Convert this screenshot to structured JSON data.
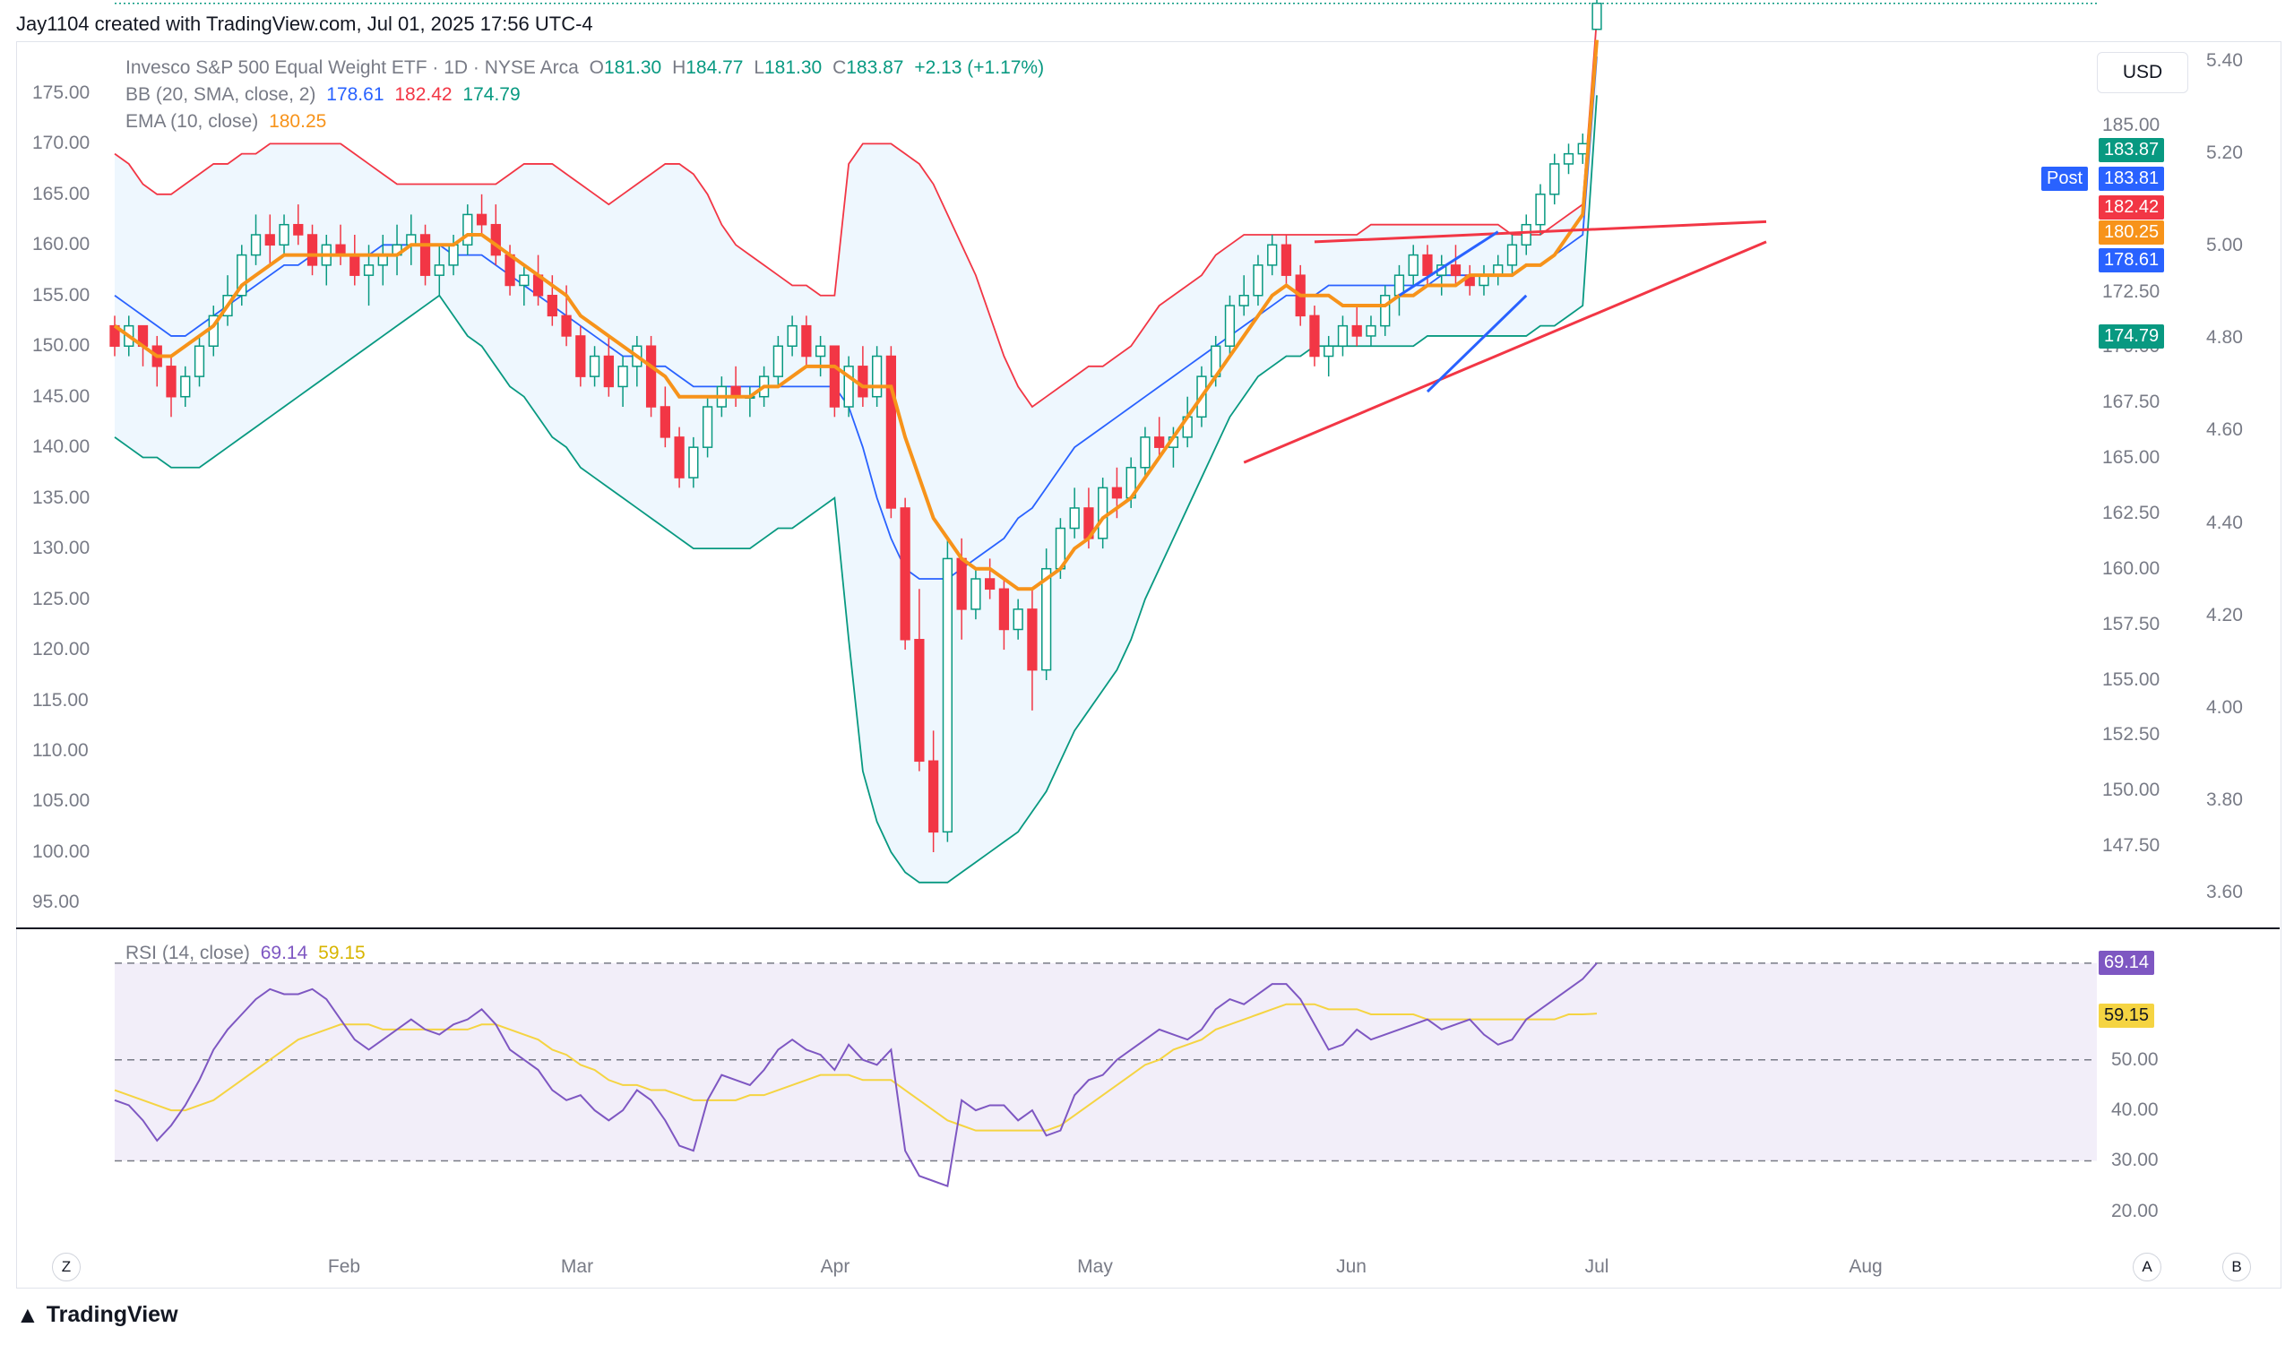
{
  "header": {
    "text": "Jay1104 created with TradingView.com, Jul 01, 2025 17:56 UTC-4"
  },
  "currency_button": "USD",
  "legend": {
    "symbol": "Invesco S&P 500 Equal Weight ETF · 1D · NYSE Arca",
    "o_label": "O",
    "o_value": "181.30",
    "h_label": "H",
    "h_value": "184.77",
    "l_label": "L",
    "l_value": "181.30",
    "c_label": "C",
    "c_value": "183.87",
    "change": "+2.13 (+1.17%)",
    "bb_label": "BB (20, SMA, close, 2)",
    "bb_basis": "178.61",
    "bb_upper": "182.42",
    "bb_lower": "174.79",
    "ema_label": "EMA (10, close)",
    "ema_value": "180.25",
    "rsi_label": "RSI (14, close)",
    "rsi_value": "69.14",
    "rsi_ma": "59.15"
  },
  "price_tags": {
    "last": "183.87",
    "post_label": "Post",
    "post": "183.81",
    "bb_upper": "182.42",
    "ema": "180.25",
    "bb_basis": "178.61",
    "bb_lower": "174.79",
    "rsi": "69.14",
    "rsi_ma": "59.15"
  },
  "colors": {
    "up": "#089981",
    "down": "#f23645",
    "bb_upper": "#f23645",
    "bb_basis": "#2962ff",
    "bb_lower": "#089981",
    "ema": "#f7931a",
    "rsi": "#7e57c2",
    "rsi_ma": "#f5d442",
    "post": "#2962ff"
  },
  "left_axis": [
    "175.00",
    "170.00",
    "165.00",
    "160.00",
    "155.00",
    "150.00",
    "145.00",
    "140.00",
    "135.00",
    "130.00",
    "125.00",
    "120.00",
    "115.00",
    "110.00",
    "105.00",
    "100.00",
    "95.00"
  ],
  "right_axis_mid": [
    "185.00",
    "177.50",
    "172.50",
    "170.00",
    "167.50",
    "165.00",
    "162.50",
    "160.00",
    "157.50",
    "155.00",
    "152.50",
    "150.00",
    "147.50"
  ],
  "right_axis_outer": [
    "5.40",
    "5.20",
    "5.00",
    "4.80",
    "4.60",
    "4.40",
    "4.20",
    "4.00",
    "3.80",
    "3.60"
  ],
  "rsi_axis": [
    "50.00",
    "40.00",
    "30.00",
    "20.00"
  ],
  "time_axis": [
    "Feb",
    "Mar",
    "Apr",
    "May",
    "Jun",
    "Jul",
    "Aug"
  ],
  "corner_left": "Z",
  "corner_right_a": "A",
  "corner_right_b": "B",
  "footer_logo": "TradingView",
  "chart_data": {
    "type": "candlestick",
    "title": "Invesco S&P 500 Equal Weight ETF · 1D · NYSE Arca",
    "ylim": [
      93,
      178
    ],
    "rsi_ylim": [
      15,
      70
    ],
    "time_labels": [
      "Feb",
      "Mar",
      "Apr",
      "May",
      "Jun",
      "Jul",
      "Aug"
    ],
    "candles_ohlc": [
      [
        152,
        153,
        149,
        150
      ],
      [
        150,
        153,
        149,
        152
      ],
      [
        152,
        152,
        148,
        150
      ],
      [
        150,
        151,
        146,
        148
      ],
      [
        148,
        149,
        143,
        145
      ],
      [
        145,
        148,
        144,
        147
      ],
      [
        147,
        151,
        146,
        150
      ],
      [
        150,
        154,
        149,
        153
      ],
      [
        153,
        157,
        152,
        155
      ],
      [
        155,
        160,
        154,
        159
      ],
      [
        159,
        163,
        158,
        161
      ],
      [
        161,
        163,
        158,
        160
      ],
      [
        160,
        163,
        159,
        162
      ],
      [
        162,
        164,
        160,
        161
      ],
      [
        161,
        162,
        157,
        158
      ],
      [
        158,
        161,
        156,
        160
      ],
      [
        160,
        162,
        158,
        159
      ],
      [
        159,
        161,
        156,
        157
      ],
      [
        157,
        160,
        154,
        158
      ],
      [
        158,
        161,
        156,
        159
      ],
      [
        159,
        162,
        157,
        160
      ],
      [
        160,
        163,
        158,
        161
      ],
      [
        161,
        162,
        156,
        157
      ],
      [
        157,
        160,
        155,
        158
      ],
      [
        158,
        161,
        157,
        160
      ],
      [
        160,
        164,
        159,
        163
      ],
      [
        163,
        165,
        161,
        162
      ],
      [
        162,
        164,
        158,
        159
      ],
      [
        159,
        160,
        155,
        156
      ],
      [
        156,
        158,
        154,
        157
      ],
      [
        157,
        159,
        154,
        155
      ],
      [
        155,
        157,
        152,
        153
      ],
      [
        153,
        156,
        150,
        151
      ],
      [
        151,
        152,
        146,
        147
      ],
      [
        147,
        150,
        146,
        149
      ],
      [
        149,
        151,
        145,
        146
      ],
      [
        146,
        149,
        144,
        148
      ],
      [
        148,
        151,
        146,
        150
      ],
      [
        150,
        151,
        143,
        144
      ],
      [
        144,
        146,
        140,
        141
      ],
      [
        141,
        142,
        136,
        137
      ],
      [
        137,
        141,
        136,
        140
      ],
      [
        140,
        145,
        139,
        144
      ],
      [
        144,
        147,
        143,
        146
      ],
      [
        146,
        148,
        144,
        145
      ],
      [
        145,
        146,
        143,
        145
      ],
      [
        145,
        148,
        144,
        147
      ],
      [
        147,
        151,
        146,
        150
      ],
      [
        150,
        153,
        149,
        152
      ],
      [
        152,
        153,
        148,
        149
      ],
      [
        149,
        151,
        147,
        150
      ],
      [
        150,
        150,
        143,
        144
      ],
      [
        144,
        149,
        143,
        148
      ],
      [
        148,
        150,
        144,
        145
      ],
      [
        145,
        150,
        144,
        149
      ],
      [
        149,
        150,
        133,
        134
      ],
      [
        134,
        135,
        120,
        121
      ],
      [
        121,
        126,
        108,
        109
      ],
      [
        109,
        112,
        100,
        102
      ],
      [
        102,
        131,
        101,
        129
      ],
      [
        129,
        131,
        121,
        124
      ],
      [
        124,
        128,
        123,
        127
      ],
      [
        127,
        129,
        125,
        126
      ],
      [
        126,
        127,
        120,
        122
      ],
      [
        122,
        125,
        121,
        124
      ],
      [
        124,
        126,
        114,
        118
      ],
      [
        118,
        130,
        117,
        128
      ],
      [
        128,
        133,
        127,
        132
      ],
      [
        132,
        136,
        131,
        134
      ],
      [
        134,
        136,
        130,
        131
      ],
      [
        131,
        137,
        130,
        136
      ],
      [
        136,
        138,
        133,
        135
      ],
      [
        135,
        139,
        134,
        138
      ],
      [
        138,
        142,
        137,
        141
      ],
      [
        141,
        143,
        139,
        140
      ],
      [
        140,
        142,
        138,
        141
      ],
      [
        141,
        145,
        140,
        143
      ],
      [
        143,
        148,
        142,
        147
      ],
      [
        147,
        151,
        146,
        150
      ],
      [
        150,
        155,
        149,
        154
      ],
      [
        154,
        157,
        153,
        155
      ],
      [
        155,
        159,
        154,
        158
      ],
      [
        158,
        161,
        157,
        160
      ],
      [
        160,
        161,
        156,
        157
      ],
      [
        157,
        158,
        152,
        153
      ],
      [
        153,
        154,
        148,
        149
      ],
      [
        149,
        151,
        147,
        150
      ],
      [
        150,
        153,
        149,
        152
      ],
      [
        152,
        154,
        150,
        151
      ],
      [
        151,
        153,
        150,
        152
      ],
      [
        152,
        156,
        151,
        155
      ],
      [
        155,
        158,
        153,
        157
      ],
      [
        157,
        160,
        156,
        159
      ],
      [
        159,
        160,
        156,
        157
      ],
      [
        157,
        159,
        155,
        158
      ],
      [
        158,
        160,
        156,
        157
      ],
      [
        157,
        158,
        155,
        156
      ],
      [
        156,
        158,
        155,
        157
      ],
      [
        157,
        159,
        156,
        158
      ],
      [
        158,
        161,
        157,
        160
      ],
      [
        160,
        163,
        159,
        162
      ],
      [
        162,
        166,
        161,
        165
      ],
      [
        165,
        169,
        164,
        168
      ],
      [
        168,
        170,
        167,
        169
      ],
      [
        169,
        171,
        168,
        170
      ],
      [
        181.3,
        184.77,
        181.3,
        183.87
      ]
    ],
    "series": [
      {
        "name": "BB upper",
        "values": [
          169,
          168,
          166,
          165,
          165,
          166,
          167,
          168,
          168,
          169,
          169,
          170,
          170,
          170,
          170,
          170,
          170,
          169,
          168,
          167,
          166,
          166,
          166,
          166,
          166,
          166,
          166,
          166,
          167,
          168,
          168,
          168,
          167,
          166,
          165,
          164,
          165,
          166,
          167,
          168,
          168,
          167,
          165,
          162,
          160,
          159,
          158,
          157,
          156,
          156,
          155,
          155,
          168,
          170,
          170,
          170,
          169,
          168,
          166,
          163,
          160,
          157,
          153,
          149,
          146,
          144,
          145,
          146,
          147,
          148,
          148,
          149,
          150,
          152,
          154,
          155,
          156,
          157,
          159,
          160,
          161,
          161,
          161,
          161,
          161,
          161,
          161,
          161,
          161,
          162,
          162,
          162,
          162,
          162,
          162,
          162,
          162,
          162,
          162,
          161,
          161,
          161,
          162,
          163,
          164,
          182.42
        ]
      },
      {
        "name": "BB basis",
        "values": [
          155,
          154,
          153,
          152,
          151,
          151,
          152,
          153,
          154,
          155,
          156,
          157,
          158,
          158,
          159,
          159,
          159,
          159,
          159,
          160,
          160,
          160,
          160,
          160,
          159,
          159,
          159,
          158,
          157,
          156,
          155,
          154,
          153,
          152,
          151,
          150,
          149,
          149,
          148,
          148,
          147,
          146,
          146,
          146,
          146,
          146,
          146,
          146,
          146,
          146,
          146,
          146,
          144,
          140,
          135,
          131,
          128,
          127,
          127,
          127,
          128,
          129,
          130,
          131,
          133,
          134,
          136,
          138,
          140,
          141,
          142,
          143,
          144,
          145,
          146,
          147,
          148,
          149,
          150,
          151,
          152,
          153,
          154,
          155,
          155,
          155,
          156,
          156,
          156,
          156,
          156,
          156,
          156,
          156,
          157,
          157,
          157,
          157,
          157,
          157,
          158,
          158,
          159,
          160,
          161,
          178.61
        ]
      },
      {
        "name": "BB lower",
        "values": [
          141,
          140,
          139,
          139,
          138,
          138,
          138,
          139,
          140,
          141,
          142,
          143,
          144,
          145,
          146,
          147,
          148,
          149,
          150,
          151,
          152,
          153,
          154,
          155,
          153,
          151,
          150,
          148,
          146,
          145,
          143,
          141,
          140,
          138,
          137,
          136,
          135,
          134,
          133,
          132,
          131,
          130,
          130,
          130,
          130,
          130,
          131,
          132,
          132,
          133,
          134,
          135,
          121,
          108,
          103,
          100,
          98,
          97,
          97,
          97,
          98,
          99,
          100,
          101,
          102,
          104,
          106,
          109,
          112,
          114,
          116,
          118,
          121,
          125,
          128,
          131,
          134,
          137,
          140,
          143,
          145,
          147,
          148,
          149,
          149,
          150,
          150,
          150,
          150,
          150,
          150,
          150,
          150,
          151,
          151,
          151,
          151,
          151,
          151,
          151,
          151,
          152,
          152,
          153,
          154,
          174.79
        ]
      },
      {
        "name": "EMA",
        "values": [
          152,
          151,
          150,
          149,
          149,
          150,
          151,
          152,
          154,
          156,
          157,
          158,
          159,
          159,
          159,
          159,
          159,
          159,
          159,
          159,
          159,
          160,
          160,
          160,
          160,
          161,
          161,
          160,
          159,
          158,
          157,
          156,
          155,
          153,
          152,
          151,
          150,
          149,
          148,
          147,
          145,
          145,
          145,
          145,
          145,
          145,
          146,
          146,
          147,
          148,
          148,
          148,
          147,
          146,
          146,
          146,
          141,
          137,
          133,
          131,
          129,
          128,
          128,
          127,
          126,
          126,
          127,
          128,
          130,
          131,
          133,
          134,
          135,
          137,
          139,
          141,
          143,
          145,
          147,
          149,
          151,
          153,
          155,
          156,
          155,
          155,
          155,
          154,
          154,
          154,
          154,
          155,
          155,
          156,
          156,
          156,
          157,
          157,
          157,
          157,
          158,
          158,
          159,
          161,
          163,
          180.25
        ]
      }
    ],
    "rsi": [
      42,
      41,
      38,
      34,
      37,
      41,
      46,
      52,
      56,
      59,
      62,
      64,
      63,
      63,
      64,
      62,
      58,
      54,
      52,
      54,
      56,
      58,
      56,
      55,
      57,
      58,
      60,
      57,
      52,
      50,
      48,
      44,
      42,
      43,
      40,
      38,
      40,
      44,
      42,
      38,
      33,
      32,
      42,
      47,
      46,
      45,
      48,
      52,
      54,
      52,
      51,
      48,
      53,
      50,
      49,
      52,
      32,
      27,
      26,
      25,
      42,
      40,
      41,
      41,
      38,
      40,
      35,
      36,
      43,
      46,
      47,
      50,
      52,
      54,
      56,
      55,
      54,
      56,
      60,
      62,
      61,
      63,
      65,
      65,
      62,
      57,
      52,
      53,
      56,
      54,
      55,
      56,
      57,
      58,
      56,
      57,
      58,
      55,
      53,
      54,
      58,
      60,
      62,
      64,
      66,
      69.14
    ],
    "rsi_ma": [
      44,
      43,
      42,
      41,
      40,
      40,
      41,
      42,
      44,
      46,
      48,
      50,
      52,
      54,
      55,
      56,
      57,
      57,
      57,
      56,
      56,
      56,
      56,
      56,
      56,
      56,
      57,
      57,
      56,
      55,
      54,
      52,
      51,
      49,
      48,
      46,
      45,
      45,
      44,
      44,
      43,
      42,
      42,
      42,
      42,
      43,
      43,
      44,
      45,
      46,
      47,
      47,
      47,
      46,
      46,
      46,
      44,
      42,
      40,
      38,
      37,
      36,
      36,
      36,
      36,
      36,
      36,
      37,
      39,
      41,
      43,
      45,
      47,
      49,
      50,
      52,
      53,
      54,
      56,
      57,
      58,
      59,
      60,
      61,
      61,
      61,
      60,
      60,
      60,
      59,
      59,
      59,
      59,
      58,
      58,
      58,
      58,
      58,
      58,
      58,
      58,
      58,
      58,
      59,
      59,
      59.15
    ]
  }
}
